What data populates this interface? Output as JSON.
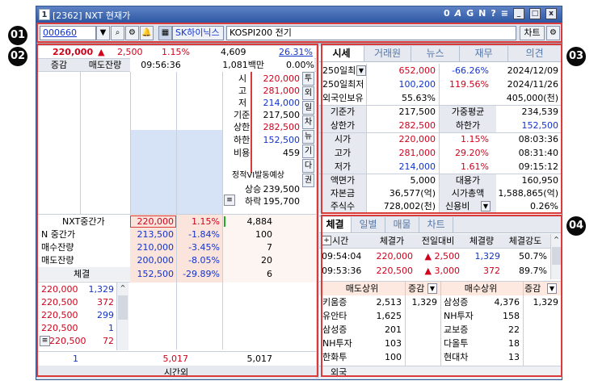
{
  "badges": {
    "b1": "01",
    "b2": "02",
    "b3": "03",
    "b4": "04"
  },
  "title": {
    "icon": "1",
    "text": "[2362] NXT 현재가",
    "tools": [
      "0",
      "A",
      "G",
      "N",
      "?",
      "≡"
    ]
  },
  "toolbar": {
    "code": "000660",
    "name": "SK하이닉스",
    "sector": "KOSPI200 전기",
    "chart_label": "차트"
  },
  "quote": {
    "price": "220,000",
    "arrow": "▲",
    "change": "2,500",
    "rate": "1.15%",
    "volume": "4,609",
    "ratio": "26.31%"
  },
  "ob_header": {
    "c1": "증감",
    "c2": "매도잔량",
    "time": "09:56:36",
    "amount": "1,081백만",
    "pct": "0.00%"
  },
  "ob_side": {
    "rows": [
      {
        "label": "시",
        "value": "220,000",
        "color": "red"
      },
      {
        "label": "고",
        "value": "281,000",
        "color": "red"
      },
      {
        "label": "저",
        "value": "214,000",
        "color": "blue"
      },
      {
        "label": "기준",
        "value": "217,500",
        "color": "black"
      },
      {
        "label": "상한",
        "value": "282,500",
        "color": "red"
      },
      {
        "label": "하한",
        "value": "152,500",
        "color": "blue"
      },
      {
        "label": "비용",
        "value": "459",
        "color": "black"
      }
    ],
    "vi_label": "정적VI발동예상",
    "up_label": "상승",
    "up_value": "239,500",
    "down_label": "하락",
    "down_value": "195,700",
    "btns": [
      "투",
      "외",
      "일",
      "차",
      "뉴",
      "기",
      "다",
      "권"
    ]
  },
  "nxt": {
    "rows": [
      {
        "label": "NXT중간가",
        "price": "220,000",
        "rate": "1.15%",
        "qty": "4,884"
      },
      {
        "label": "N 중간가",
        "price": "213,500",
        "rate": "-1.84%",
        "qty": "100"
      },
      {
        "label": "매수잔량",
        "price": "210,000",
        "rate": "-3.45%",
        "qty": "7"
      },
      {
        "label": "매도잔량",
        "price": "200,000",
        "rate": "-8.05%",
        "qty": "20"
      },
      {
        "label": "체결",
        "price": "152,500",
        "rate": "-29.89%",
        "qty": "6"
      }
    ]
  },
  "trades": [
    {
      "p": "220,000",
      "q": "1,329",
      "qc": "blue"
    },
    {
      "p": "220,500",
      "q": "372",
      "qc": "red"
    },
    {
      "p": "220,500",
      "q": "299",
      "qc": "blue"
    },
    {
      "p": "220,500",
      "q": "1",
      "qc": "blue"
    },
    {
      "p": "220,500",
      "q": "72",
      "qc": "red"
    }
  ],
  "ob_footer": {
    "left": "1",
    "mid": "5,017",
    "right": "5,017",
    "after_hours": "시간외"
  },
  "info_tabs": [
    "시세",
    "거래원",
    "뉴스",
    "재무",
    "의견"
  ],
  "info": {
    "rows": [
      {
        "l": "250일최",
        "v1": "652,000",
        "v2": "-66.26%",
        "v3": "2024/12/09"
      },
      {
        "l": "250일최저",
        "v1": "100,200",
        "v2": "119.56%",
        "v3": "2024/11/26"
      },
      {
        "l": "외국인보유",
        "v1": "55.63%",
        "v2": "",
        "v3": "405,000(천)"
      },
      {
        "l": "기준가",
        "v1": "217,500",
        "v2": "가중평균",
        "v3": "234,539"
      },
      {
        "l": "상한가",
        "v1": "282,500",
        "v2": "하한가",
        "v3": "152,500"
      },
      {
        "l": "시가",
        "v1": "220,000",
        "v2": "1.15%",
        "v3": "08:03:36"
      },
      {
        "l": "고가",
        "v1": "281,000",
        "v2": "29.20%",
        "v3": "08:31:40"
      },
      {
        "l": "저가",
        "v1": "214,000",
        "v2": "1.61%",
        "v3": "09:15:12"
      },
      {
        "l": "액면가",
        "v1": "5,000",
        "v2": "대용가",
        "v3": "160,950"
      },
      {
        "l": "자본금",
        "v1": "36,577(억)",
        "v2": "시가총액",
        "v3": "1,588,865(억)"
      },
      {
        "l": "주식수",
        "v1": "728,002(천)",
        "v2": "신용비",
        "v3": "0.26%"
      }
    ]
  },
  "exec_tabs": [
    "체결",
    "일별",
    "매물",
    "차트"
  ],
  "exec": {
    "headers": [
      "시간",
      "체결가",
      "전일대비",
      "체결량",
      "체결강도"
    ],
    "rows": [
      {
        "t": "09:54:04",
        "p": "220,000",
        "d": "▲ 2,500",
        "q": "1,329",
        "s": "50.7%"
      },
      {
        "t": "09:53:36",
        "p": "220,500",
        "d": "▲ 3,000",
        "q": "372",
        "s": "89.7%"
      }
    ]
  },
  "brokers": {
    "sell_header": "매도상위",
    "buy_header": "매수상위",
    "sort_label": "증감",
    "sell": [
      {
        "n": "키움증",
        "v": "2,513",
        "d": "1,329"
      },
      {
        "n": "유안타",
        "v": "1,625",
        "d": ""
      },
      {
        "n": "삼성증",
        "v": "201",
        "d": ""
      },
      {
        "n": "NH투자",
        "v": "103",
        "d": ""
      },
      {
        "n": "한화투",
        "v": "100",
        "d": ""
      }
    ],
    "buy": [
      {
        "n": "삼성증",
        "v": "4,376",
        "d": "1,329"
      },
      {
        "n": "NH투자",
        "v": "158",
        "d": ""
      },
      {
        "n": "교보증",
        "v": "22",
        "d": ""
      },
      {
        "n": "다올투",
        "v": "18",
        "d": ""
      },
      {
        "n": "현대차",
        "v": "13",
        "d": ""
      }
    ],
    "foreign_label": "외국"
  }
}
